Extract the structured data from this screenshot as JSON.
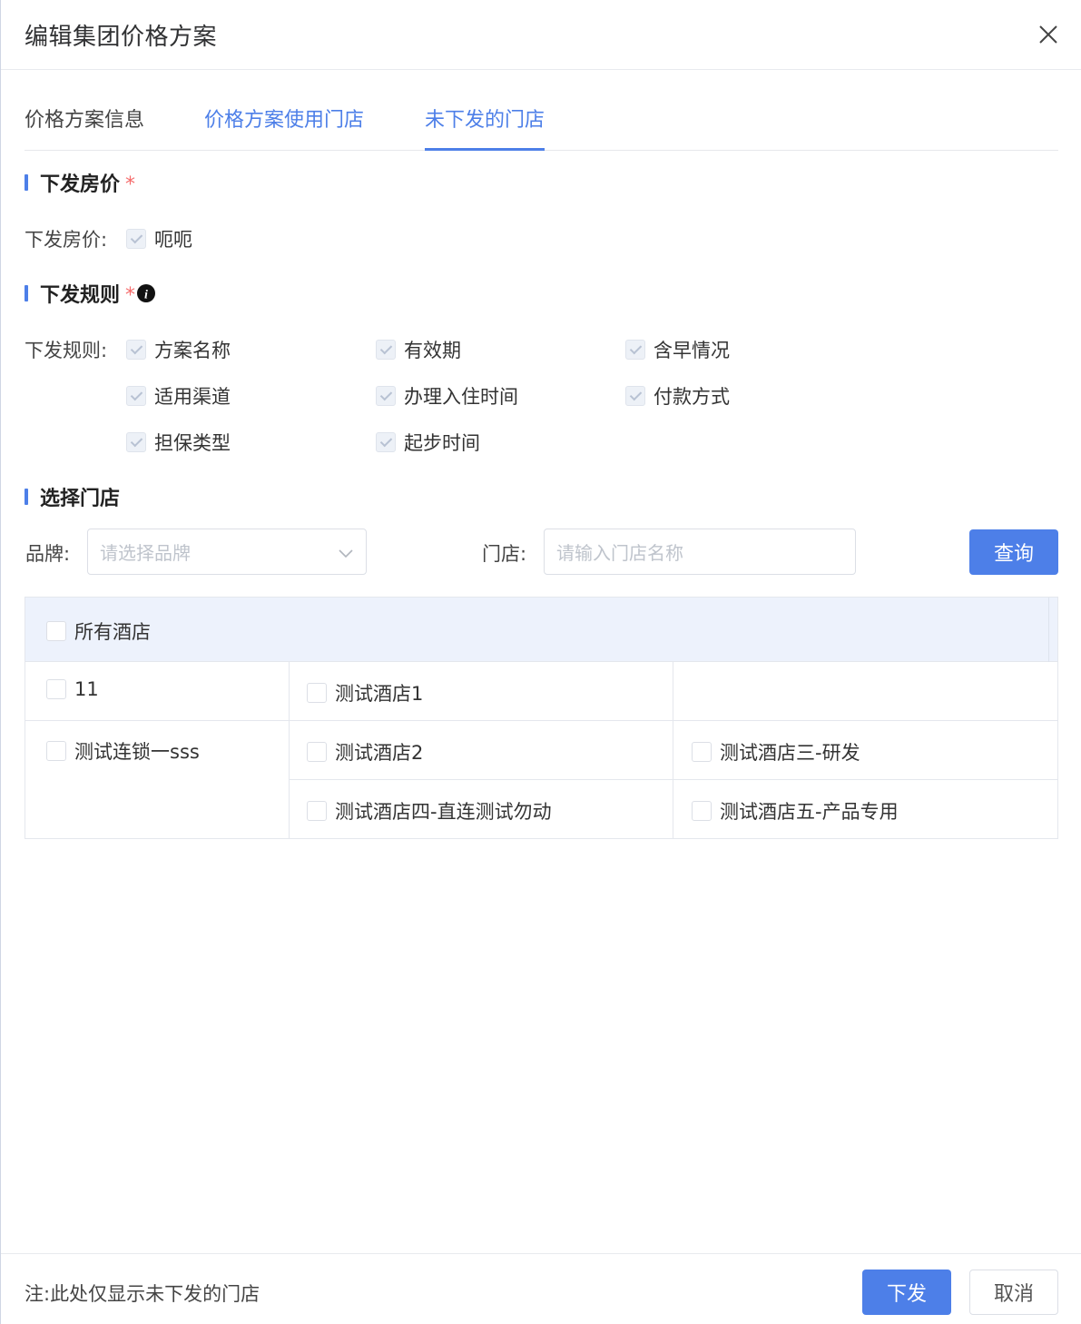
{
  "dialog": {
    "title": "编辑集团价格方案",
    "close_icon": "close-icon"
  },
  "tabs": [
    {
      "label": "价格方案信息"
    },
    {
      "label": "价格方案使用门店"
    },
    {
      "label": "未下发的门店",
      "active": true
    }
  ],
  "section_price": {
    "title": "下发房价",
    "required_mark": "*",
    "label": "下发房价:",
    "options": [
      {
        "label": "呃呃",
        "checked": true,
        "disabled": true
      }
    ]
  },
  "section_rules": {
    "title": "下发规则",
    "required_mark": "*",
    "info_icon": "info-icon",
    "label": "下发规则:",
    "options": [
      {
        "label": "方案名称",
        "checked": true,
        "disabled": true
      },
      {
        "label": "有效期",
        "checked": true,
        "disabled": true
      },
      {
        "label": "含早情况",
        "checked": true,
        "disabled": true
      },
      {
        "label": "适用渠道",
        "checked": true,
        "disabled": true
      },
      {
        "label": "办理入住时间",
        "checked": true,
        "disabled": true
      },
      {
        "label": "付款方式",
        "checked": true,
        "disabled": true
      },
      {
        "label": "担保类型",
        "checked": true,
        "disabled": true
      },
      {
        "label": "起步时间",
        "checked": true,
        "disabled": true
      }
    ]
  },
  "section_store": {
    "title": "选择门店",
    "brand_label": "品牌:",
    "brand_placeholder": "请选择品牌",
    "store_label": "门店:",
    "store_placeholder": "请输入门店名称",
    "query_button": "查询"
  },
  "table": {
    "header_checkbox_label": "所有酒店",
    "groups": [
      {
        "brand": "11",
        "stores": [
          "测试酒店1"
        ]
      },
      {
        "brand": "测试连锁一sss",
        "stores": [
          "测试酒店2",
          "测试酒店三-研发",
          "测试酒店四-直连测试勿动",
          "测试酒店五-产品专用"
        ]
      }
    ]
  },
  "footer": {
    "note": "注:此处仅显示未下发的门店",
    "submit_button": "下发",
    "cancel_button": "取消"
  },
  "colors": {
    "accent": "#4d7fe8",
    "required": "#f56c6c",
    "table_header_bg": "#edf2fc"
  }
}
